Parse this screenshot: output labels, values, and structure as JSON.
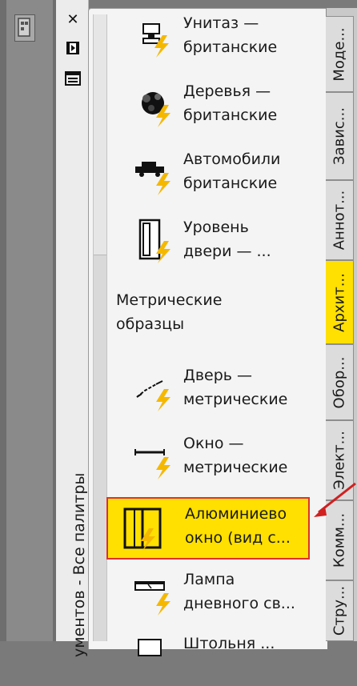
{
  "palette": {
    "title": "Инструментов - Все палитры",
    "title_visible": "ументов - Все палитры",
    "titlebar_buttons": [
      "close",
      "autohide",
      "properties"
    ]
  },
  "items": [
    {
      "label": "Унитаз —\nбританские",
      "icon": "toilet-icon"
    },
    {
      "label": "Деревья —\nбританские",
      "icon": "tree-icon"
    },
    {
      "label": "Автомобили\nбританские",
      "icon": "car-icon"
    },
    {
      "label": "Уровень\nдвери — ...",
      "icon": "door-level-icon"
    }
  ],
  "section_title": "Метрические\nобразцы",
  "metric_items": [
    {
      "label": "Дверь —\nметрические",
      "icon": "door-icon"
    },
    {
      "label": "Окно —\nметрические",
      "icon": "window-icon"
    },
    {
      "label": "Алюминиево\nокно (вид с...",
      "icon": "aluminum-window-icon",
      "selected": true
    },
    {
      "label": "Лампа\nдневного св...",
      "icon": "lamp-icon"
    },
    {
      "label": "Штольня ...",
      "icon": "stair-icon"
    }
  ],
  "tabs": [
    {
      "label": "Моде..."
    },
    {
      "label": "Завис..."
    },
    {
      "label": "Аннот..."
    },
    {
      "label": "Архит...",
      "active": true
    },
    {
      "label": "Обор..."
    },
    {
      "label": "Элект..."
    },
    {
      "label": "Комм..."
    },
    {
      "label": "Стру..."
    }
  ],
  "colors": {
    "selected_bg": "#ffe000",
    "selected_border": "#e03030",
    "active_tab": "#ffe000",
    "lightning": "#f5b800"
  }
}
